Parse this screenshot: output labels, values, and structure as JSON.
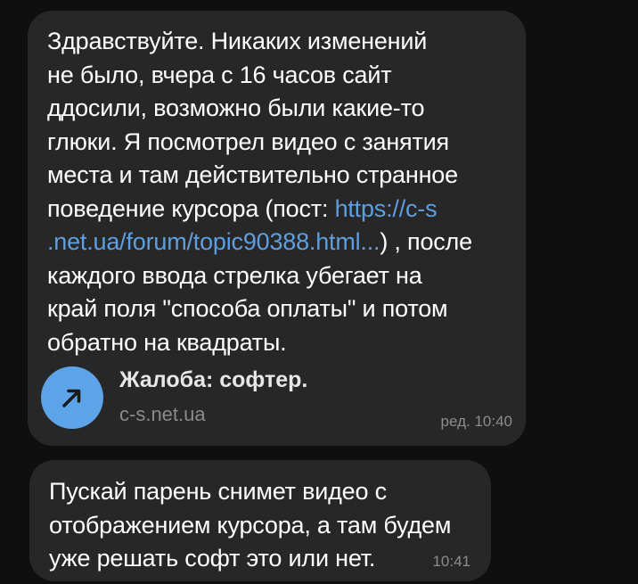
{
  "messages": [
    {
      "text_before_link": "Здравствуйте. Никаких изменений\nне было, вчера с 16 часов сайт\nддосили, возможно были какие-то\nглюки. Я посмотрел видео с занятия\nместа и там действительно странное\nповедение курсора (пост: ",
      "link": "https://c-s\n.net.ua/forum/topic90388.html...",
      "text_after_link": ") , после\nкаждого ввода стрелка убегает на\nкрай поля \"способа оплаты\" и потом\nобратно на квадраты.",
      "preview": {
        "title": "Жалоба: софтер.",
        "domain": "c-s.net.ua",
        "icon": "arrow-up-right-icon"
      },
      "time": "ред. 10:40"
    },
    {
      "text": "Пускай парень снимет видео с\nотображением курсора, а там будем\nуже решать софт это или нет.",
      "time": "10:41"
    }
  ],
  "colors": {
    "background": "#0f0f0f",
    "bubble": "#272727",
    "link": "#5d9fe0",
    "preview_accent": "#5da3e8",
    "meta": "#8c8c8c"
  }
}
